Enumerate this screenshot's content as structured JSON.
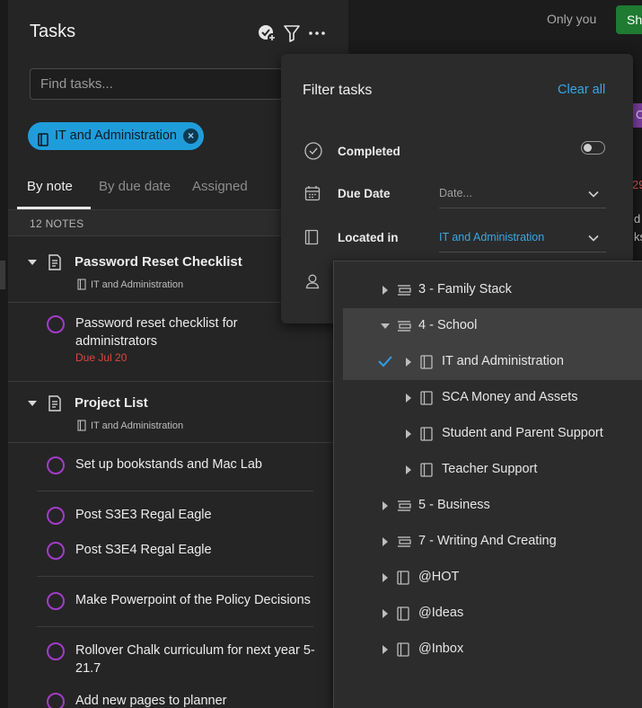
{
  "background": {
    "only_you": "Only you",
    "share_label": "Sh",
    "purple_tag_fragment": "C",
    "red_fragment": "29",
    "text_fragment_1": "d",
    "text_fragment_2": "ks"
  },
  "tasks_panel": {
    "title": "Tasks",
    "search_placeholder": "Find tasks...",
    "filter_chip": "IT and Administration",
    "tabs": [
      {
        "label": "By note",
        "active": true
      },
      {
        "label": "By due date",
        "active": false
      },
      {
        "label": "Assigned",
        "active": false
      }
    ],
    "count_label": "12 NOTES",
    "notes": [
      {
        "title": "Password Reset Checklist",
        "notebook": "IT and Administration",
        "tasks": [
          {
            "text": "Password reset checklist for administrators",
            "due": "Due Jul 20"
          }
        ]
      },
      {
        "title": "Project List",
        "notebook": "IT and Administration",
        "tasks": [
          {
            "text": "Set up bookstands and Mac Lab"
          },
          {
            "text": "Post S3E3 Regal Eagle"
          },
          {
            "text": "Post S3E4 Regal Eagle"
          },
          {
            "text": "Make Powerpoint of the Policy Decisions"
          },
          {
            "text": "Rollover Chalk curriculum for next year 5-21.7"
          },
          {
            "text": "Add new pages to planner"
          }
        ]
      }
    ]
  },
  "filter_popup": {
    "title": "Filter tasks",
    "clear_all": "Clear all",
    "completed_label": "Completed",
    "completed_on": false,
    "due_date_label": "Due Date",
    "due_date_value": "Date...",
    "located_in_label": "Located in",
    "located_in_value": "IT and Administration"
  },
  "location_tree": [
    {
      "label": "3 - Family Stack",
      "type": "stack",
      "level": 0,
      "expanded": false,
      "selected": false
    },
    {
      "label": "4 - School",
      "type": "stack",
      "level": 0,
      "expanded": true,
      "selected": false
    },
    {
      "label": "IT and Administration",
      "type": "notebook",
      "level": 1,
      "expanded": false,
      "selected": true
    },
    {
      "label": "SCA Money and Assets",
      "type": "notebook",
      "level": 1,
      "expanded": false,
      "selected": false
    },
    {
      "label": "Student and Parent Support",
      "type": "notebook",
      "level": 1,
      "expanded": false,
      "selected": false
    },
    {
      "label": "Teacher Support",
      "type": "notebook",
      "level": 1,
      "expanded": false,
      "selected": false
    },
    {
      "label": "5 - Business",
      "type": "stack",
      "level": 0,
      "expanded": false,
      "selected": false
    },
    {
      "label": "7 - Writing And Creating",
      "type": "stack",
      "level": 0,
      "expanded": false,
      "selected": false
    },
    {
      "label": "@HOT",
      "type": "notebook",
      "level": 0,
      "expanded": false,
      "selected": false
    },
    {
      "label": "@Ideas",
      "type": "notebook",
      "level": 0,
      "expanded": false,
      "selected": false
    },
    {
      "label": "@Inbox",
      "type": "notebook",
      "level": 0,
      "expanded": false,
      "selected": false
    }
  ],
  "colors": {
    "accent_blue": "#1f9ddb",
    "link_blue": "#3aa6e6",
    "task_circle_purple": "#a23cc8",
    "due_red": "#e2453c",
    "share_green": "#1f7a32"
  }
}
